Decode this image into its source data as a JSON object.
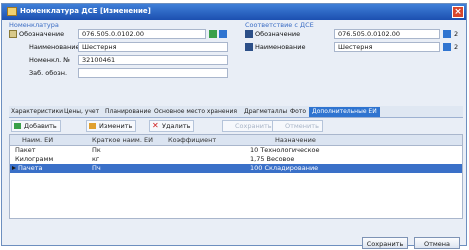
{
  "window": {
    "title": "Номенклатура ДСЕ [Изменение]"
  },
  "nomenclature": {
    "group_label": "Номенклатура",
    "designation_label": "Обозначение",
    "designation_value": "076.505.0.0102.00",
    "name_label": "Наименование",
    "name_value": "Шестерня",
    "item_no_label": "Номенкл. №",
    "item_no_value": "32100461",
    "replacement_label": "Заб. обозн.",
    "replacement_value": ""
  },
  "dse": {
    "group_label": "Соответствие с ДСЕ",
    "designation_label": "Обозначение",
    "designation_value": "076.505.0.0102.00",
    "designation_count": "2",
    "name_label": "Наименование",
    "name_value": "Шестерня",
    "name_count": "2"
  },
  "tabs": [
    "Характеристики",
    "Цены, учет",
    "Планирование",
    "Основное место хранения",
    "Драгметаллы",
    "Фото",
    "Дополнительные ЕИ"
  ],
  "toolbar": {
    "add": "Добавить",
    "edit": "Изменить",
    "delete": "Удалить",
    "save": "Сохранить",
    "cancel": "Отменить"
  },
  "table": {
    "columns": [
      "Наим. ЕИ",
      "Краткое наим. ЕИ",
      "Коэффициент",
      "Назначение"
    ],
    "rows": [
      {
        "name": "Пакет",
        "short": "Пк",
        "coef": "",
        "purpose": "10 Технологическое"
      },
      {
        "name": "Килограмм",
        "short": "кг",
        "coef": "",
        "purpose": "1,75 Весовое"
      },
      {
        "name": "Пачета",
        "short": "Пч",
        "coef": "",
        "purpose": "100 Складирование"
      }
    ]
  },
  "footer": {
    "save": "Сохранить",
    "cancel": "Отмена"
  },
  "colors": {
    "accent": "#2f74d0",
    "titlebar": "#1c4fb0",
    "selection": "#3a70c8"
  }
}
